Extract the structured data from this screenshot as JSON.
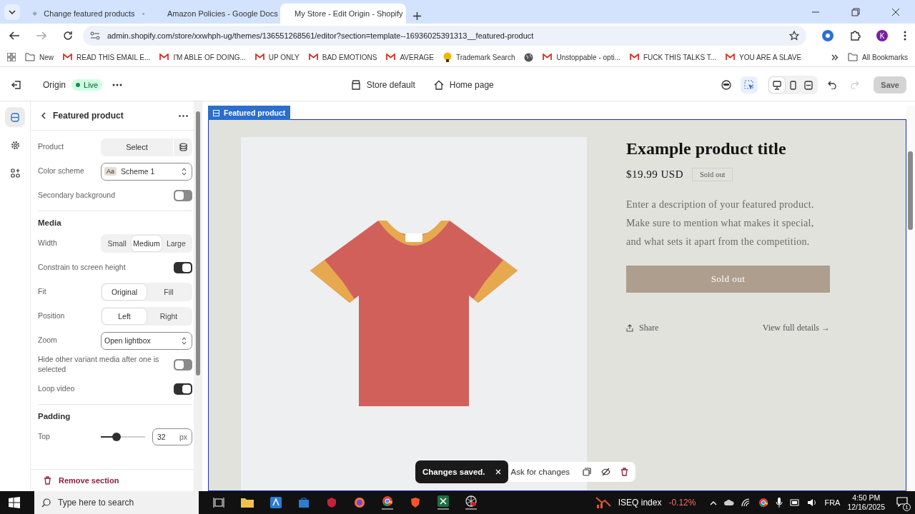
{
  "browser": {
    "tabs": [
      {
        "title": "Change featured products",
        "kind": "chat",
        "selected": false
      },
      {
        "title": "Amazon Policies - Google Docs",
        "kind": "docs",
        "selected": false
      },
      {
        "title": "My Store - Edit Origin - Shopify",
        "kind": "shop",
        "selected": true
      }
    ],
    "url": "admin.shopify.com/store/xxwhph-ug/themes/136551268561/editor?section=template--16936025391313__featured-product",
    "profile": "K",
    "bookmarks": [
      {
        "label": "New",
        "kind": "folder"
      },
      {
        "label": "READ THIS EMAIL E...",
        "kind": "mail"
      },
      {
        "label": "I'M ABLE OF DOING...",
        "kind": "mail"
      },
      {
        "label": "UP ONLY",
        "kind": "mail"
      },
      {
        "label": "BAD EMOTIONS",
        "kind": "mail"
      },
      {
        "label": "AVERAGE",
        "kind": "mail"
      },
      {
        "label": "Trademark Search",
        "kind": "bulb"
      },
      {
        "kind": "globe"
      },
      {
        "label": "Unstoppable - opti...",
        "kind": "mail"
      },
      {
        "label": "FUCK THIS TALKS T...",
        "kind": "mail"
      },
      {
        "label": "YOU ARE A SLAVE",
        "kind": "mail"
      }
    ],
    "all_bookmarks": "All Bookmarks"
  },
  "editor": {
    "theme": "Origin",
    "status": "Live",
    "template": "Store default",
    "page": "Home page",
    "save": "Save",
    "save_disabled": true,
    "views": [
      {
        "kind": "desktop",
        "selected": true
      },
      {
        "kind": "mobile",
        "selected": false
      },
      {
        "kind": "fullwidth",
        "selected": false
      }
    ],
    "inspect_on": true,
    "rail": [
      {
        "kind": "sections",
        "selected": true
      },
      {
        "kind": "settings",
        "selected": false
      },
      {
        "kind": "apps",
        "selected": false
      }
    ]
  },
  "panel": {
    "title": "Featured product",
    "remove": "Remove section",
    "settings": [
      {
        "kind": "picker",
        "label": "Product",
        "button": "Select"
      },
      {
        "kind": "select",
        "label": "Color scheme",
        "swatch": "Aa",
        "value": "Scheme 1"
      },
      {
        "kind": "toggle",
        "label": "Secondary background",
        "on": false
      },
      {
        "kind": "heading",
        "label": "Media"
      },
      {
        "kind": "segmented",
        "label": "Width",
        "options": [
          {
            "label": "Small",
            "selected": false
          },
          {
            "label": "Medium",
            "selected": true
          },
          {
            "label": "Large",
            "selected": false
          }
        ]
      },
      {
        "kind": "toggle",
        "label": "Constrain to screen height",
        "on": true
      },
      {
        "kind": "segmented",
        "label": "Fit",
        "options": [
          {
            "label": "Original",
            "selected": true
          },
          {
            "label": "Fill",
            "selected": false
          }
        ]
      },
      {
        "kind": "segmented",
        "label": "Position",
        "options": [
          {
            "label": "Left",
            "selected": true
          },
          {
            "label": "Right",
            "selected": false
          }
        ]
      },
      {
        "kind": "select",
        "label": "Zoom",
        "value": "Open lightbox"
      },
      {
        "kind": "toggle",
        "label": "Hide other variant media after one is selected",
        "on": false
      },
      {
        "kind": "toggle",
        "label": "Loop video",
        "on": true
      },
      {
        "kind": "heading",
        "label": "Padding"
      },
      {
        "kind": "slider",
        "label": "Top",
        "level": 0.35,
        "value": "32",
        "unit": "px"
      }
    ]
  },
  "preview": {
    "section_label": "Featured product",
    "title": "Example product title",
    "price": "$19.99 USD",
    "badge": "Sold out",
    "description": "Enter a description of your featured product. Make sure to mention what makes it special, and what sets it apart from the competition.",
    "button": "Sold out",
    "share": "Share",
    "details": "View full details →",
    "toast": "Changes saved.",
    "ask": "Ask for changes"
  },
  "taskbar": {
    "search_placeholder": "Type here to search",
    "ticker": "ISEQ index",
    "change": "-0.12%",
    "language": "FRA",
    "time": "4:50 PM",
    "date": "12/16/2025",
    "notifications": "1"
  }
}
